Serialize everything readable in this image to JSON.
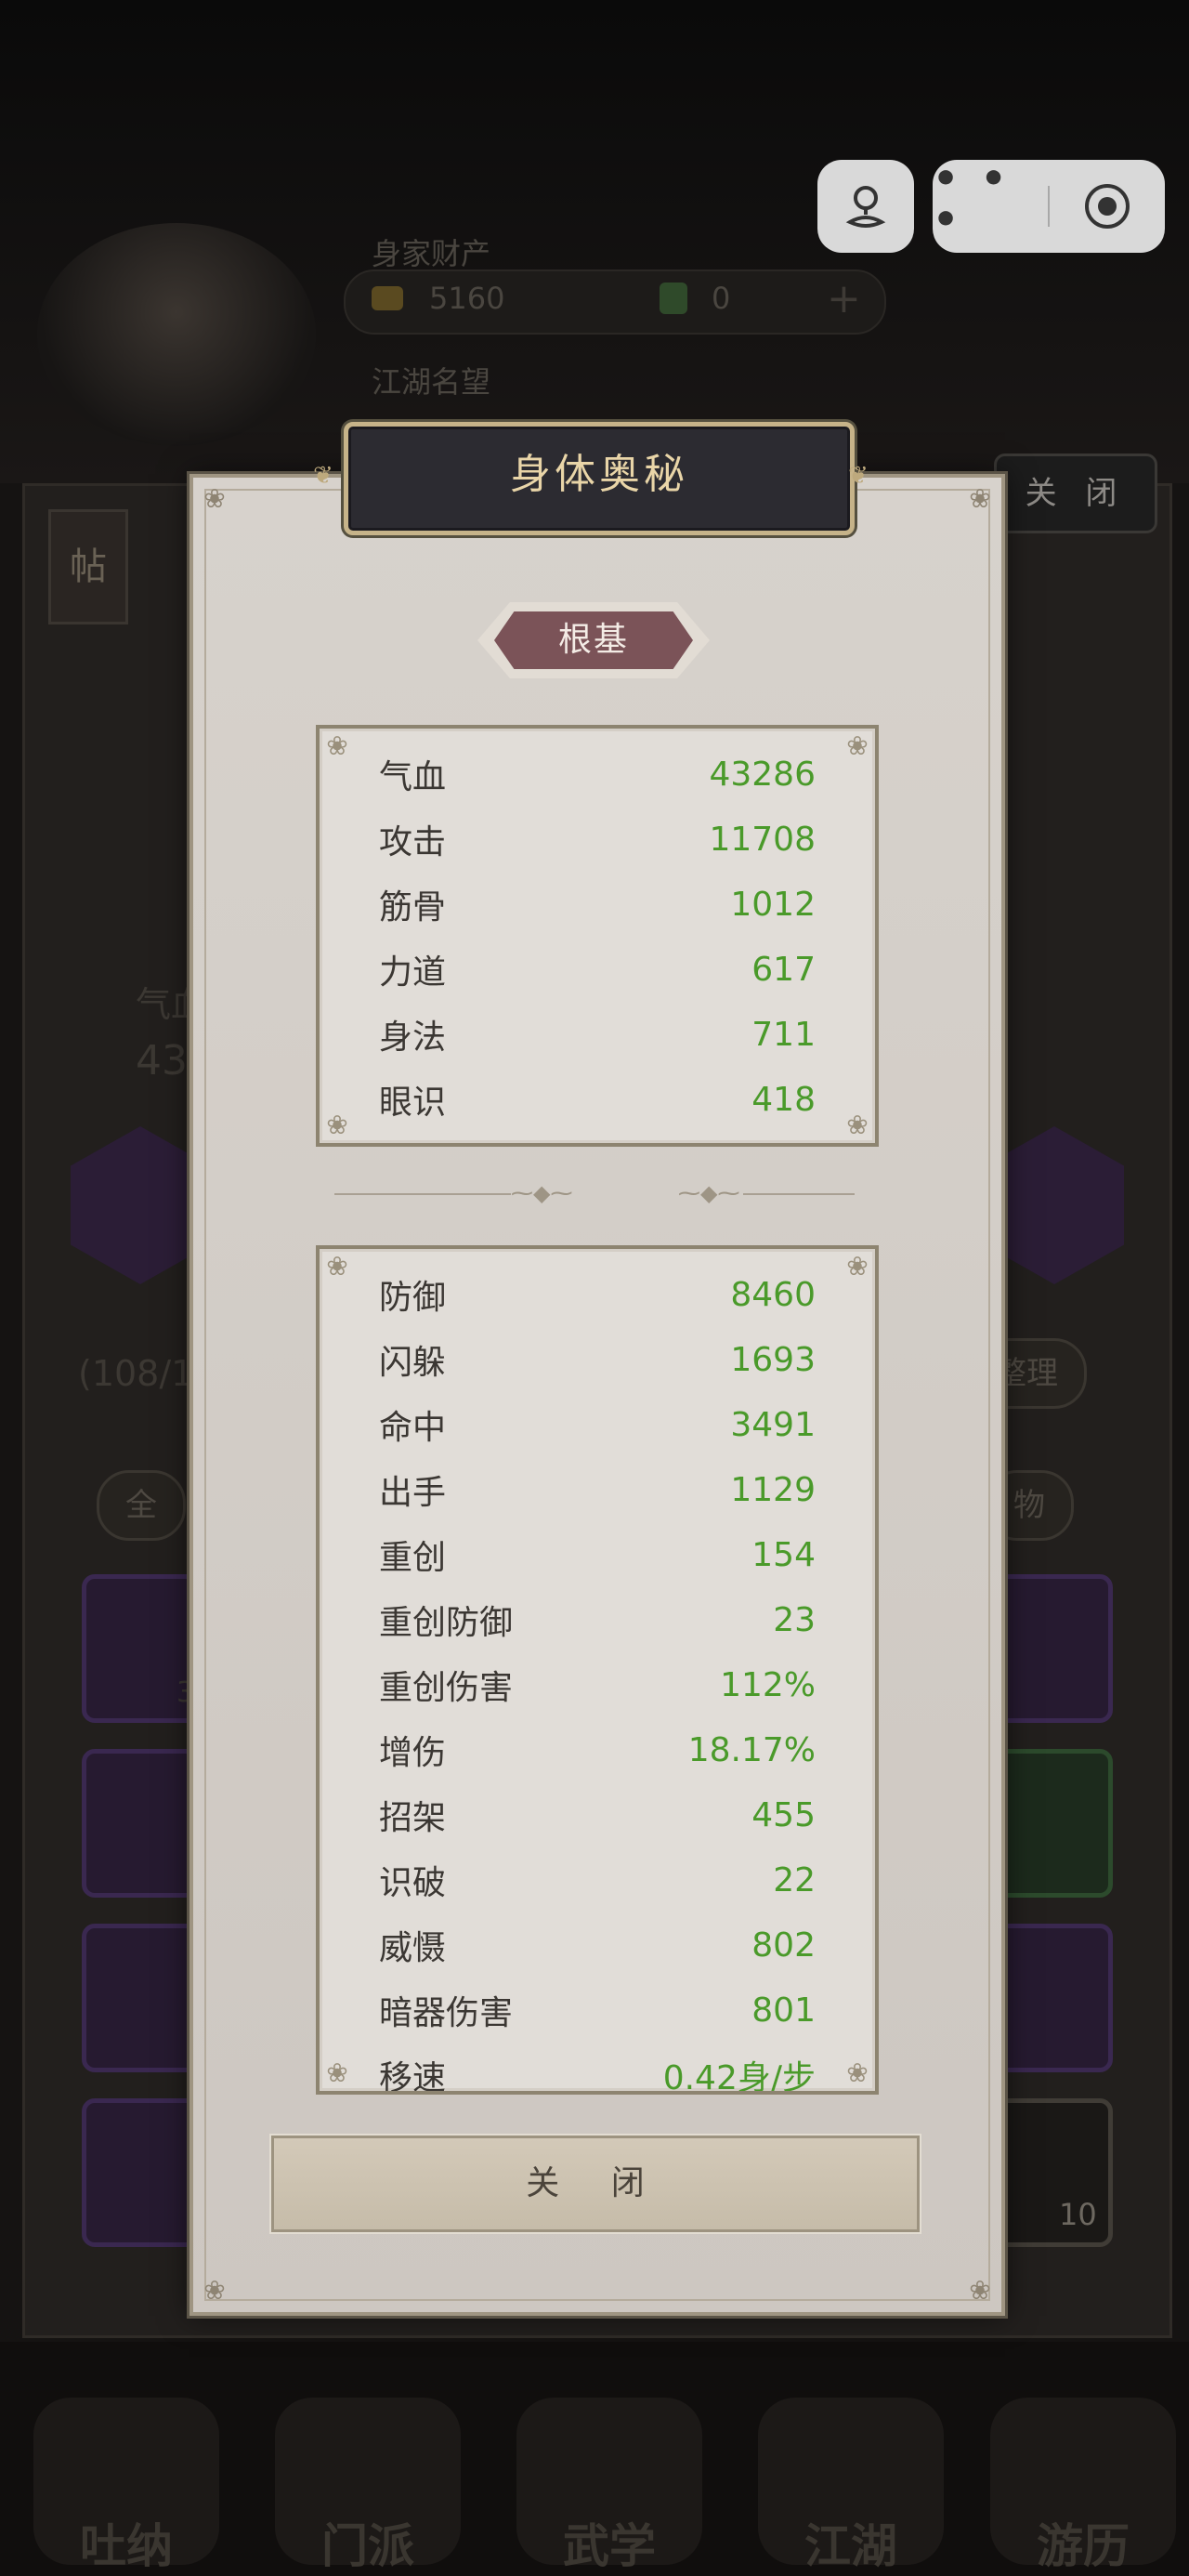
{
  "background": {
    "wealth_title": "身家财产",
    "copper": "5160",
    "gold": "0",
    "fame_title": "江湖名望",
    "close_tab": "关 闭",
    "post_icon": "帖",
    "stat_short": "气血",
    "stat_short_val": "43",
    "bag_count": "(108/14",
    "sort_button": "整理",
    "filter_all": "全",
    "filter_item": "物",
    "item_count_1": "3",
    "item_count_2": "10",
    "nav": [
      "吐纳",
      "门派",
      "武学",
      "江湖",
      "游历"
    ]
  },
  "modal": {
    "title": "身体奥秘",
    "tab_label": "根基",
    "base_stats": [
      {
        "name": "气血",
        "value": "43286"
      },
      {
        "name": "攻击",
        "value": "11708"
      },
      {
        "name": "筋骨",
        "value": "1012"
      },
      {
        "name": "力道",
        "value": "617"
      },
      {
        "name": "身法",
        "value": "711"
      },
      {
        "name": "眼识",
        "value": "418"
      }
    ],
    "combat_stats": [
      {
        "name": "防御",
        "value": "8460"
      },
      {
        "name": "闪躲",
        "value": "1693"
      },
      {
        "name": "命中",
        "value": "3491"
      },
      {
        "name": "出手",
        "value": "1129"
      },
      {
        "name": "重创",
        "value": "154"
      },
      {
        "name": "重创防御",
        "value": "23"
      },
      {
        "name": "重创伤害",
        "value": "112%"
      },
      {
        "name": "增伤",
        "value": "18.17%"
      },
      {
        "name": "招架",
        "value": "455"
      },
      {
        "name": "识破",
        "value": "22"
      },
      {
        "name": "威慑",
        "value": "802"
      },
      {
        "name": "暗器伤害",
        "value": "801"
      },
      {
        "name": "移速",
        "value": "0.42身/步"
      }
    ],
    "close_label": "关 闭"
  },
  "colors": {
    "stat_value": "#4a9a2a",
    "title_text": "#e9d5a8",
    "tab_fill": "#7b5358"
  }
}
